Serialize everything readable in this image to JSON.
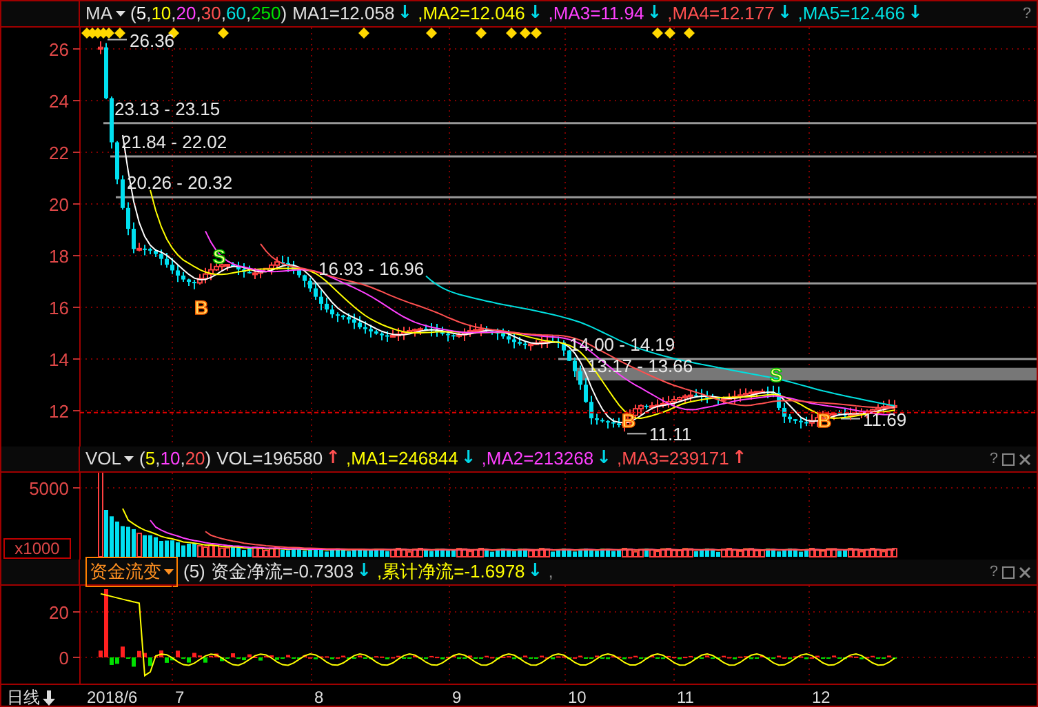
{
  "main_header": {
    "indicator": "MA",
    "params": [
      {
        "text": "(",
        "color": "#e0e0e0"
      },
      {
        "text": "5",
        "color": "#ffffff"
      },
      {
        "text": ",",
        "color": "#e0e0e0"
      },
      {
        "text": "10",
        "color": "#ffff00"
      },
      {
        "text": ",",
        "color": "#e0e0e0"
      },
      {
        "text": "20",
        "color": "#ff40ff"
      },
      {
        "text": ",",
        "color": "#e0e0e0"
      },
      {
        "text": "30",
        "color": "#ff5050"
      },
      {
        "text": ",",
        "color": "#e0e0e0"
      },
      {
        "text": "60",
        "color": "#00e0e0"
      },
      {
        "text": ",",
        "color": "#e0e0e0"
      },
      {
        "text": "250",
        "color": "#00e000"
      },
      {
        "text": ")",
        "color": "#e0e0e0"
      }
    ],
    "readings": [
      {
        "text": "MA1=12.058",
        "color": "#e0e0e0",
        "arrow": {
          "glyph": "↓",
          "color": "#00d8e8"
        }
      },
      {
        "text": ",MA2=12.046",
        "color": "#ffff00",
        "arrow": {
          "glyph": "↓",
          "color": "#00d8e8"
        }
      },
      {
        "text": ",MA3=11.94",
        "color": "#ff40ff",
        "arrow": {
          "glyph": "↓",
          "color": "#00d8e8"
        }
      },
      {
        "text": ",MA4=12.177",
        "color": "#ff5050",
        "arrow": {
          "glyph": "↓",
          "color": "#00d8e8"
        }
      },
      {
        "text": ",MA5=12.466",
        "color": "#00e0e0",
        "arrow": {
          "glyph": "↓",
          "color": "#00d8e8"
        }
      }
    ],
    "help": "?"
  },
  "price_axis": [
    "26",
    "24",
    "22",
    "20",
    "18",
    "16",
    "14",
    "12"
  ],
  "price_annotations": [
    {
      "text": "26.36",
      "kind": "point"
    },
    {
      "text": "23.13 - 23.15",
      "kind": "range"
    },
    {
      "text": "21.84 - 22.02",
      "kind": "range"
    },
    {
      "text": "20.26 - 20.32",
      "kind": "range"
    },
    {
      "text": "16.93 - 16.96",
      "kind": "range"
    },
    {
      "text": "14.00 - 14.19",
      "kind": "range"
    },
    {
      "text": "13.17 - 13.66",
      "kind": "band"
    },
    {
      "text": "11.11",
      "kind": "point"
    },
    {
      "text": "11.69",
      "kind": "point"
    }
  ],
  "signals": [
    {
      "label": "S",
      "kind": "sell"
    },
    {
      "label": "B",
      "kind": "buy"
    },
    {
      "label": "B",
      "kind": "buy"
    },
    {
      "label": "S",
      "kind": "sell"
    },
    {
      "label": "B",
      "kind": "buy"
    }
  ],
  "volume_header": {
    "indicator": "VOL",
    "params": [
      {
        "text": "(",
        "color": "#e0e0e0"
      },
      {
        "text": "5",
        "color": "#ffff00"
      },
      {
        "text": ",",
        "color": "#e0e0e0"
      },
      {
        "text": "10",
        "color": "#ff40ff"
      },
      {
        "text": ",",
        "color": "#e0e0e0"
      },
      {
        "text": "20",
        "color": "#ff5050"
      },
      {
        "text": ")",
        "color": "#e0e0e0"
      }
    ],
    "readings": [
      {
        "text": "VOL=196580",
        "color": "#e0e0e0",
        "arrow": {
          "glyph": "↑",
          "color": "#ff5050"
        }
      },
      {
        "text": ",MA1=246844",
        "color": "#ffff00",
        "arrow": {
          "glyph": "↓",
          "color": "#00d8e8"
        }
      },
      {
        "text": ",MA2=213268",
        "color": "#ff40ff",
        "arrow": {
          "glyph": "↓",
          "color": "#00d8e8"
        }
      },
      {
        "text": ",MA3=239171",
        "color": "#ff5050",
        "arrow": {
          "glyph": "↑",
          "color": "#ff5050"
        }
      }
    ],
    "help": "?"
  },
  "volume_axis": [
    "5000"
  ],
  "volume_unit": "x1000",
  "fund_header": {
    "indicator": "资金流变",
    "params": [
      {
        "text": "(5)",
        "color": "#e0e0e0"
      }
    ],
    "readings": [
      {
        "text": "资金净流=-0.7303",
        "color": "#e0e0e0",
        "arrow": {
          "glyph": "↓",
          "color": "#00d8e8"
        }
      },
      {
        "text": ",累计净流=-1.6978",
        "color": "#ffff00",
        "arrow": {
          "glyph": "↓",
          "color": "#00d8e8"
        }
      }
    ],
    "trailing": ",",
    "help": "?"
  },
  "fund_axis": [
    "20",
    "0"
  ],
  "period": "日线",
  "dates": [
    "2018/6",
    "7",
    "8",
    "9",
    "10",
    "11",
    "12"
  ]
}
